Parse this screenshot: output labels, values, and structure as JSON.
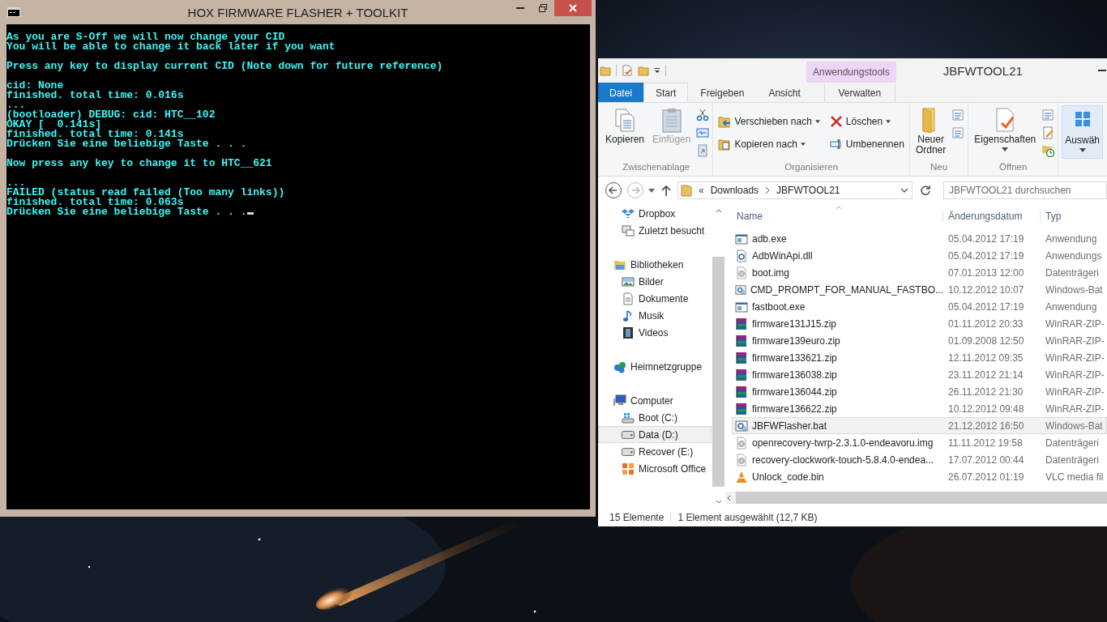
{
  "console": {
    "title": "HOX FIRMWARE FLASHER + TOOLKIT",
    "cursor": true,
    "blocks": [
      [
        "As you are S-Off we will now change your CID",
        "You will be able to change it back later if you want"
      ],
      [
        "Press any key to display current CID (Note down for future reference)"
      ],
      [
        "cid: None",
        "finished. total time: 0.016s",
        "...",
        "(bootloader) DEBUG: cid: HTC__102",
        "OKAY [  0.141s]",
        "finished. total time: 0.141s",
        "Drücken Sie eine beliebige Taste . . ."
      ],
      [
        "Now press any key to change it to HTC__621"
      ],
      [
        "...",
        "FAILED (status read failed (Too many links))",
        "finished. total time: 0.063s",
        "Drücken Sie eine beliebige Taste . . ."
      ]
    ]
  },
  "explorer": {
    "title": "JBFWTOOL21",
    "context_label": "Anwendungstools",
    "tabs": [
      {
        "label": "Datei",
        "kind": "file",
        "selected": false
      },
      {
        "label": "Start",
        "kind": "tab",
        "selected": true
      },
      {
        "label": "Freigeben",
        "kind": "tab",
        "selected": false
      },
      {
        "label": "Ansicht",
        "kind": "tab",
        "selected": false
      },
      {
        "label": "Verwalten",
        "kind": "context",
        "selected": false
      }
    ],
    "ribbon_groups": [
      {
        "label": "Zwischenablage",
        "kind": "large",
        "buttons": [
          {
            "label": "Kopieren",
            "disabled": false,
            "dropdown": false
          },
          {
            "label": "Einfügen",
            "disabled": true,
            "dropdown": false
          }
        ]
      },
      {
        "label": "Organisieren",
        "kind": "small",
        "buttons": [
          {
            "label": "Verschieben nach",
            "disabled": false,
            "dropdown": true
          },
          {
            "label": "Löschen",
            "disabled": false,
            "dropdown": true
          },
          {
            "label": "Kopieren nach",
            "disabled": false,
            "dropdown": true
          },
          {
            "label": "Umbenennen",
            "disabled": false,
            "dropdown": false
          }
        ]
      },
      {
        "label": "Neu",
        "kind": "large",
        "buttons": [
          {
            "label": "Neuer Ordner",
            "disabled": false,
            "dropdown": false
          }
        ]
      },
      {
        "label": "Öffnen",
        "kind": "large",
        "buttons": [
          {
            "label": "Eigenschaften",
            "disabled": false,
            "dropdown": true
          }
        ]
      },
      {
        "kind": "large",
        "buttons": [
          {
            "label": "Auswäh",
            "disabled": false,
            "dropdown": true
          }
        ]
      }
    ],
    "address": {
      "overflow": "«",
      "segments": [
        "Downloads",
        "JBFWTOOL21"
      ]
    },
    "search": {
      "placeholder": "JBFWTOOL21 durchsuchen"
    },
    "nav": [
      {
        "items": [
          {
            "label": "Dropbox",
            "selected": false
          },
          {
            "label": "Zuletzt besucht",
            "selected": false
          }
        ]
      },
      {
        "label": "Bibliotheken",
        "items": [
          {
            "label": "Bilder",
            "selected": false
          },
          {
            "label": "Dokumente",
            "selected": false
          },
          {
            "label": "Musik",
            "selected": false
          },
          {
            "label": "Videos",
            "selected": false
          }
        ]
      },
      {
        "label": "Heimnetzgruppe"
      },
      {
        "label": "Computer",
        "items": [
          {
            "label": "Boot (C:)",
            "selected": false
          },
          {
            "label": "Data (D:)",
            "selected": true
          },
          {
            "label": "Recover (E:)",
            "selected": false
          },
          {
            "label": "Microsoft Office",
            "selected": false
          }
        ]
      }
    ],
    "columns": [
      "Name",
      "Änderungsdatum",
      "Typ"
    ],
    "files": [
      {
        "name": "adb.exe",
        "date": "05.04.2012 17:19",
        "type": "Anwendung",
        "kind": "exe",
        "selected": false
      },
      {
        "name": "AdbWinApi.dll",
        "date": "05.04.2012 17:19",
        "type": "Anwendungs",
        "kind": "dll",
        "selected": false
      },
      {
        "name": "boot.img",
        "date": "07.01.2013 12:00",
        "type": "Datenträgeri",
        "kind": "img",
        "selected": false
      },
      {
        "name": "CMD_PROMPT_FOR_MANUAL_FASTBO...",
        "date": "10.12.2012 10:07",
        "type": "Windows-Bat",
        "kind": "bat",
        "selected": false
      },
      {
        "name": "fastboot.exe",
        "date": "05.04.2012 17:19",
        "type": "Anwendung",
        "kind": "exe",
        "selected": false
      },
      {
        "name": "firmware131J15.zip",
        "date": "01.11.2012 20:33",
        "type": "WinRAR-ZIP-",
        "kind": "zip",
        "selected": false
      },
      {
        "name": "firmware139euro.zip",
        "date": "01.09.2008 12:50",
        "type": "WinRAR-ZIP-",
        "kind": "zip",
        "selected": false
      },
      {
        "name": "firmware133621.zip",
        "date": "12.11.2012 09:35",
        "type": "WinRAR-ZIP-",
        "kind": "zip",
        "selected": false
      },
      {
        "name": "firmware136038.zip",
        "date": "23.11.2012 21:14",
        "type": "WinRAR-ZIP-",
        "kind": "zip",
        "selected": false
      },
      {
        "name": "firmware136044.zip",
        "date": "26.11.2012 21:30",
        "type": "WinRAR-ZIP-",
        "kind": "zip",
        "selected": false
      },
      {
        "name": "firmware136622.zip",
        "date": "10.12.2012 09:48",
        "type": "WinRAR-ZIP-",
        "kind": "zip",
        "selected": false
      },
      {
        "name": "JBFWFlasher.bat",
        "date": "21.12.2012 16:50",
        "type": "Windows-Bat",
        "kind": "bat",
        "selected": true
      },
      {
        "name": "openrecovery-twrp-2.3.1.0-endeavoru.img",
        "date": "11.11.2012 19:58",
        "type": "Datenträgeri",
        "kind": "img",
        "selected": false
      },
      {
        "name": "recovery-clockwork-touch-5.8.4.0-endea...",
        "date": "17.07.2012 00:44",
        "type": "Datenträgeri",
        "kind": "img",
        "selected": false
      },
      {
        "name": "Unlock_code.bin",
        "date": "26.07.2012 01:19",
        "type": "VLC media fil",
        "kind": "vlc",
        "selected": false
      }
    ],
    "status": {
      "count": "15 Elemente",
      "selection": "1 Element ausgewählt (12,7 KB)"
    }
  }
}
